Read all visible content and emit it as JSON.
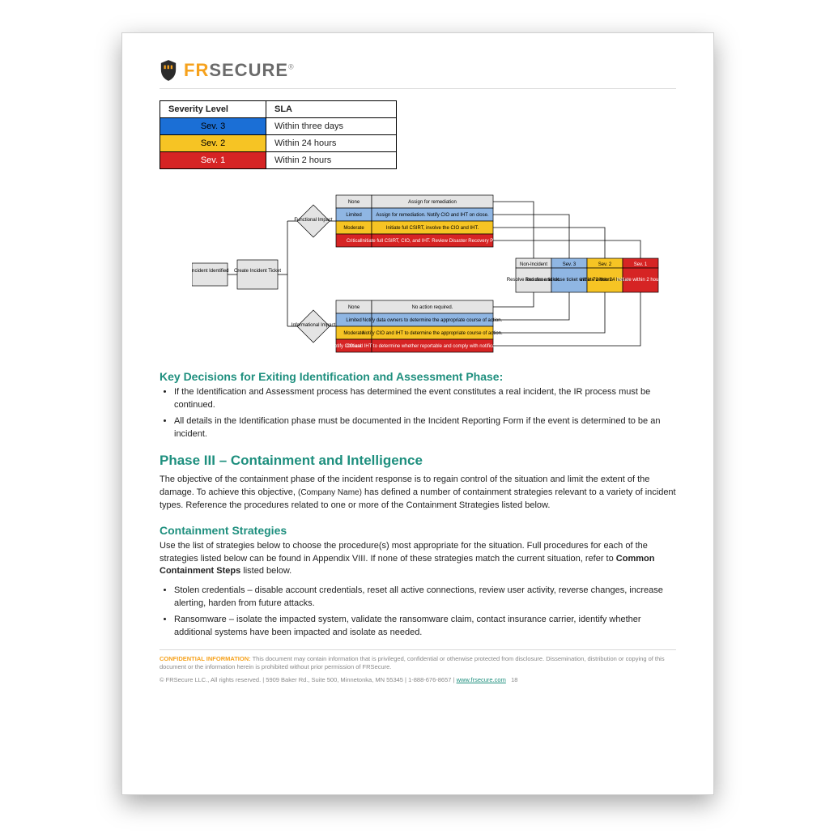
{
  "brand": {
    "fr": "FR",
    "secure": "SECURE",
    "reg": "®"
  },
  "sev_table": {
    "headers": [
      "Severity Level",
      "SLA"
    ],
    "rows": [
      {
        "level": "Sev. 3",
        "sla": "Within three days",
        "cls": "sev3"
      },
      {
        "level": "Sev. 2",
        "sla": "Within 24 hours",
        "cls": "sev2"
      },
      {
        "level": "Sev. 1",
        "sla": "Within 2 hours",
        "cls": "sev1"
      }
    ]
  },
  "diagram": {
    "start": {
      "a": "Incident Identified",
      "b": "Create Incident Ticket"
    },
    "diamond_top": "Functional Impact",
    "diamond_bot": "Informational Impact",
    "impact_levels": [
      "None",
      "Limited",
      "Moderate",
      "Critical"
    ],
    "functional_actions": [
      "Assign for remediation",
      "Assign for remediation. Notify CIO and IHT on close.",
      "Initiate full CSIRT, involve the CIO and IHT.",
      "Initiate full CSIRT, CIO, and IHT. Review Disaster Recovery Plans."
    ],
    "info_actions": [
      "No action required.",
      "Notify data owners to determine the appropriate course of action.",
      "Notify CIO and IHT to determine the appropriate course of action.",
      "Notify CIO and IHT to determine whether reportable and comply with notification requirements."
    ],
    "sla_headers": [
      "Non-Incident",
      "Sev. 3",
      "Sev. 2",
      "Sev. 1"
    ],
    "sla_actions": [
      "Resolve and close ticket.",
      "Resolve and close ticket within 72 hours.",
      "Initiate within 24 hours.",
      "Initiate within 2 hours."
    ]
  },
  "headings": {
    "key_decisions": "Key Decisions for Exiting Identification and Assessment Phase:",
    "phase3": "Phase III – Containment and Intelligence",
    "containment": "Containment Strategies"
  },
  "bullets_key": [
    "If the Identification and Assessment process has determined the event constitutes a real incident, the IR process must be continued.",
    "All details in the Identification phase must be documented in the Incident Reporting Form if the event is determined to be an incident."
  ],
  "phase3_para": {
    "pre": "The objective of the containment phase of the incident response is to regain control of the situation and limit the extent of the damage.  To achieve this objective, ",
    "company": "(Company Name)",
    "post": " has defined a number of containment strategies relevant to a variety of incident types. Reference the procedures related to one or more of the Containment Strategies listed below."
  },
  "containment_para": {
    "pre": "Use the list of strategies below to choose the procedure(s) most appropriate for the situation. Full procedures for each of the strategies listed below can be found in Appendix VIII. If none of these strategies match the current situation, refer to ",
    "em": "Common Containment Steps",
    "post": " listed below."
  },
  "bullets_strat": [
    "Stolen credentials – disable account credentials, reset all active connections, review user activity, reverse changes, increase alerting, harden from future attacks.",
    "Ransomware – isolate the impacted system, validate the ransomware claim, contact insurance carrier, identify whether additional systems have been impacted and isolate as needed."
  ],
  "footer": {
    "conf_label": "CONFIDENTIAL INFORMATION:",
    "conf_text": " This document may contain information that is privileged, confidential or otherwise protected from disclosure. Dissemination, distribution or copying of this document or the information herein is prohibited without prior permission of FRSecure.",
    "copy_pre": "© FRSecure LLC., All rights reserved. | 5909 Baker Rd., Suite 500, Minnetonka, MN 55345 | 1-888-676-8657 | ",
    "link": "www.frsecure.com",
    "page": "18"
  }
}
